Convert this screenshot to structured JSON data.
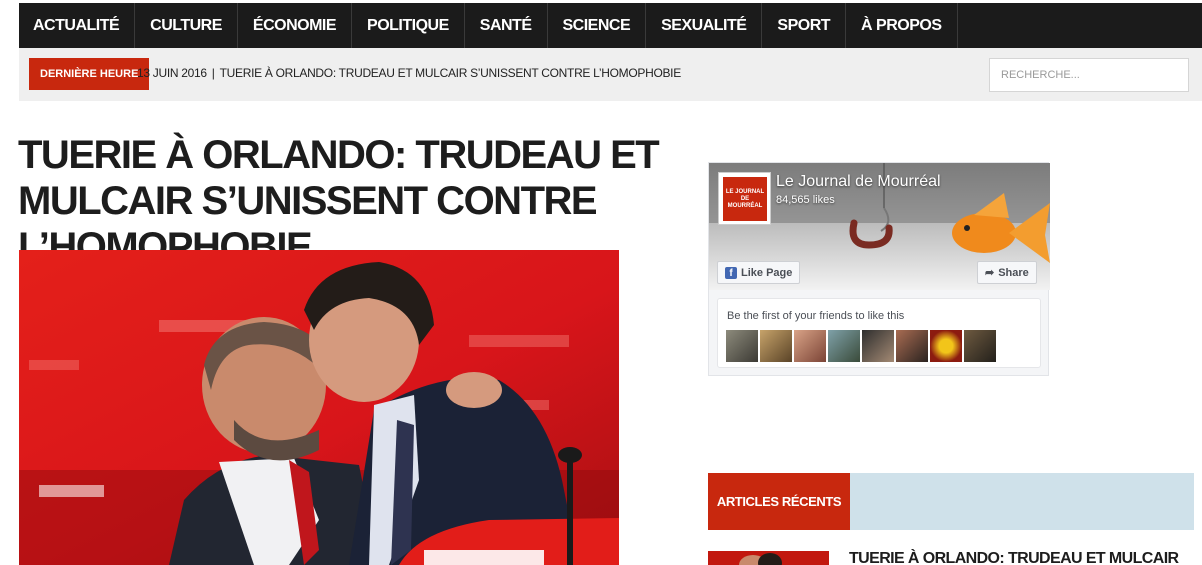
{
  "nav": {
    "items": [
      {
        "label": "ACTUALITÉ"
      },
      {
        "label": "CULTURE"
      },
      {
        "label": "ÉCONOMIE"
      },
      {
        "label": "POLITIQUE"
      },
      {
        "label": "SANTÉ"
      },
      {
        "label": "SCIENCE"
      },
      {
        "label": "SEXUALITÉ"
      },
      {
        "label": "SPORT"
      },
      {
        "label": "À PROPOS"
      }
    ]
  },
  "ticker": {
    "badge": "DERNIÈRE HEURE",
    "date": "13 JUIN 2016",
    "separator": "|",
    "headline": "TUERIE À ORLANDO: TRUDEAU ET MULCAIR S’UNISSENT CONTRE L’HOMOPHOBIE"
  },
  "search": {
    "placeholder": "RECHERCHE..."
  },
  "article": {
    "title": "TUERIE À ORLANDO: TRUDEAU ET MULCAIR S’UNISSENT CONTRE L’HOMOPHOBIE"
  },
  "facebook": {
    "page_name": "Le Journal de Mourréal",
    "likes": "84,565 likes",
    "like_label": "Like Page",
    "share_label": "Share",
    "friends_text": "Be the first of your friends to like this",
    "logo_text": "LE JOURNAL DE MOURRÉAL"
  },
  "sidebar": {
    "recent_label": "ARTICLES RÉCENTS",
    "recent_items": [
      {
        "title": "TUERIE À ORLANDO: TRUDEAU ET MULCAIR"
      }
    ]
  },
  "colors": {
    "nav_bg": "#1b1b1b",
    "accent_red": "#c8280e",
    "ticker_bg": "#efefef",
    "recent_bar_bg": "#cfe1ea",
    "facebook_blue": "#4267b2"
  }
}
